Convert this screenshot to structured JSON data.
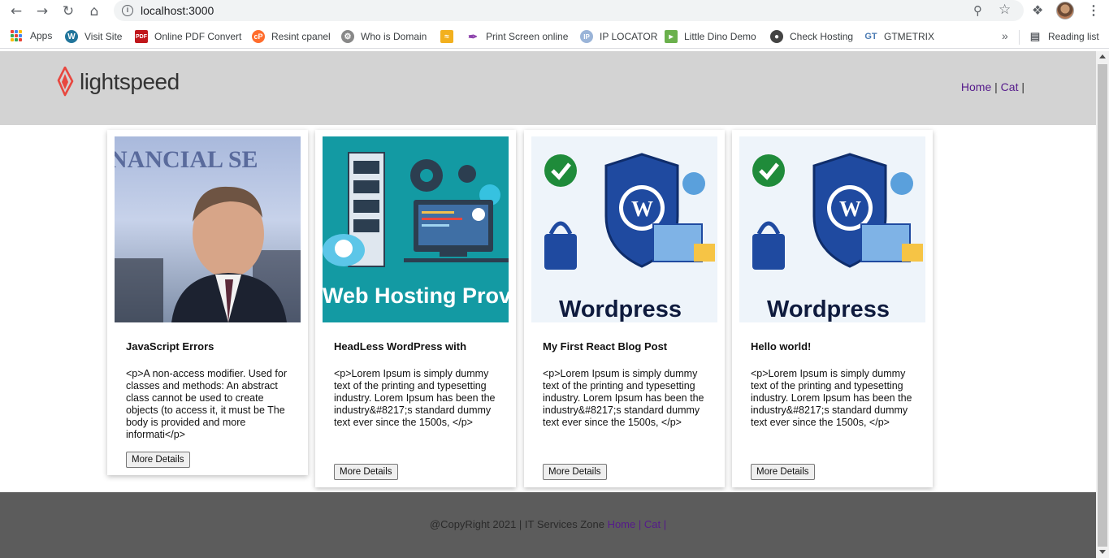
{
  "browser": {
    "url": "localhost:3000",
    "bookmarks": [
      {
        "label": "Apps",
        "icon": "apps-grid-icon"
      },
      {
        "label": "Visit Site",
        "icon": "wordpress-icon"
      },
      {
        "label": "Online PDF Convert",
        "icon": "pdf-icon"
      },
      {
        "label": "Resint cpanel",
        "icon": "cpanel-icon"
      },
      {
        "label": "Who is Domain",
        "icon": "gear-icon"
      },
      {
        "label": "",
        "icon": "tools-icon"
      },
      {
        "label": "Print Screen online",
        "icon": "feather-icon"
      },
      {
        "label": "IP LOCATOR",
        "icon": "ip-icon"
      },
      {
        "label": "Little Dino Demo",
        "icon": "dino-icon"
      },
      {
        "label": "Check Hosting",
        "icon": "globe-icon"
      },
      {
        "label": "GTMETRIX",
        "icon": "gtmetrix-icon"
      }
    ],
    "more_bookmarks": "»",
    "reading_list": "Reading list"
  },
  "site": {
    "logo_text": "lightspeed",
    "nav": {
      "home": "Home",
      "sep1": " | ",
      "cat": "Cat",
      "sep2": " |"
    },
    "footer": {
      "copy": "@CopyRight 2021 | IT Services Zone ",
      "home": "Home",
      "sep1": " | ",
      "cat": "Cat",
      "sep2": " |"
    }
  },
  "posts": [
    {
      "title": "JavaScript Errors",
      "excerpt": "<p>A non-access modifier. Used for classes and methods: An abstract class cannot be used to create objects (to access it, it must be The body is provided and more informati</p>",
      "button": "More Details",
      "image": "person-photo"
    },
    {
      "title": "HeadLess WordPress with",
      "excerpt": "<p>Lorem Ipsum is simply dummy text of the printing and typesetting industry. Lorem Ipsum has been the industry&#8217;s standard dummy text ever since the 1500s, </p>",
      "button": "More Details",
      "image": "web-hosting-illustration",
      "image_caption": "Web Hosting Prov"
    },
    {
      "title": "My First React Blog Post",
      "excerpt": "<p>Lorem Ipsum is simply dummy text of the printing and typesetting industry. Lorem Ipsum has been the industry&#8217;s standard dummy text ever since the 1500s, </p>",
      "button": "More Details",
      "image": "wordpress-security-illustration",
      "image_caption": "Wordpress"
    },
    {
      "title": "Hello world!",
      "excerpt": "<p>Lorem Ipsum is simply dummy text of the printing and typesetting industry. Lorem Ipsum has been the industry&#8217;s standard dummy text ever since the 1500s, </p>",
      "button": "More Details",
      "image": "wordpress-security-illustration",
      "image_caption": "Wordpress"
    }
  ],
  "colors": {
    "header_bg": "#d3d3d3",
    "footer_bg": "#5c5c5c",
    "link": "#551a8b",
    "logo_red": "#e8473f"
  }
}
